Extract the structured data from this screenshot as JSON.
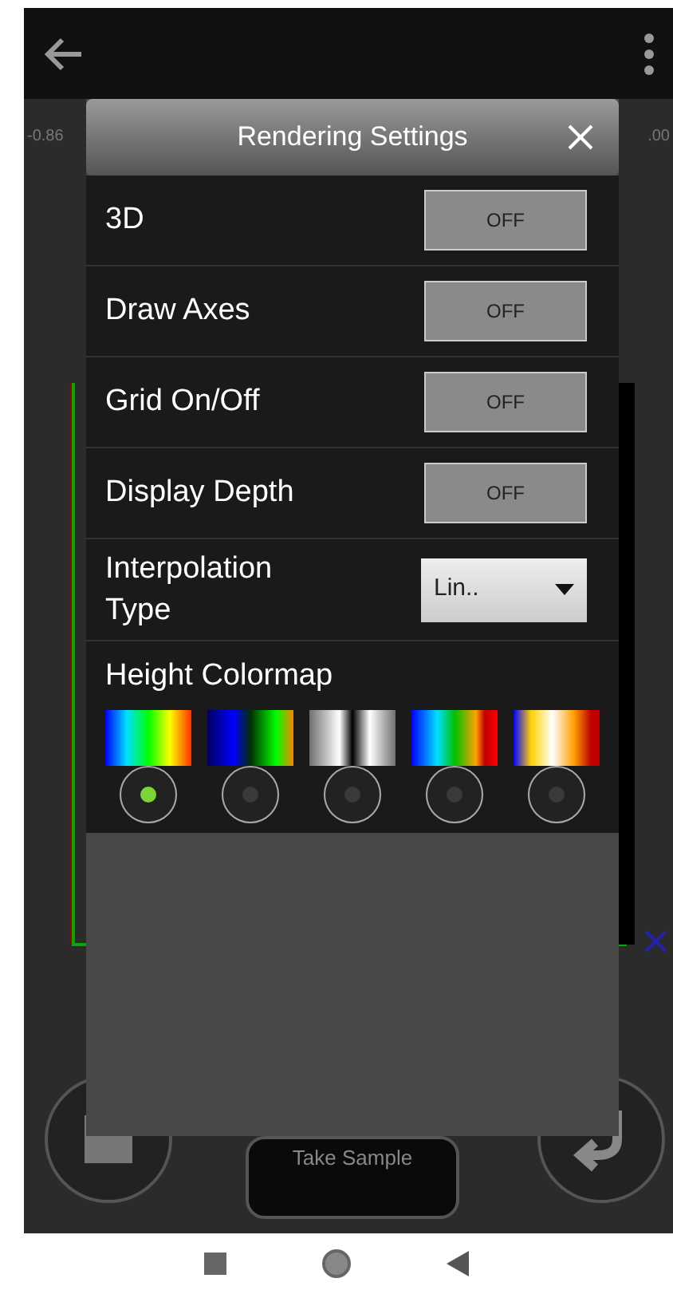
{
  "axis_labels": [
    "-0.86",
    ".00"
  ],
  "dialog": {
    "title": "Rendering Settings",
    "toggles": [
      {
        "label": "3D",
        "value": "OFF",
        "on": false
      },
      {
        "label": "Draw Axes",
        "value": "OFF",
        "on": false
      },
      {
        "label": "Grid On/Off",
        "value": "OFF",
        "on": false
      },
      {
        "label": "Display Depth",
        "value": "OFF",
        "on": false
      }
    ],
    "interpolation": {
      "label": "Interpolation Type",
      "value": "Lin.."
    },
    "colormap": {
      "label": "Height Colormap",
      "options": [
        {
          "selected": true
        },
        {
          "selected": false
        },
        {
          "selected": false
        },
        {
          "selected": false
        },
        {
          "selected": false
        }
      ]
    }
  },
  "take_sample": "Take Sample"
}
